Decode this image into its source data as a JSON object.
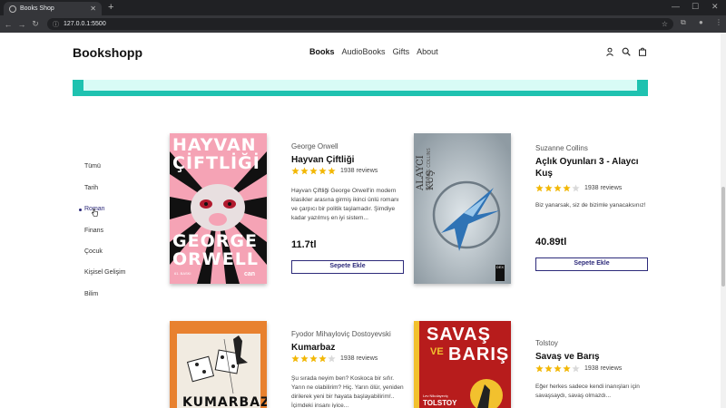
{
  "browser": {
    "tab_title": "Books Shop",
    "new_tab": "+",
    "url": "127.0.0.1:5500"
  },
  "header": {
    "logo": "Bookshopp",
    "nav": [
      {
        "label": "Books",
        "active": true
      },
      {
        "label": "AudioBooks",
        "active": false
      },
      {
        "label": "Gifts",
        "active": false
      },
      {
        "label": "About",
        "active": false
      }
    ]
  },
  "sidebar": {
    "items": [
      {
        "label": "Tümü",
        "active": false
      },
      {
        "label": "Tarih",
        "active": false
      },
      {
        "label": "Roman",
        "active": true
      },
      {
        "label": "Finans",
        "active": false
      },
      {
        "label": "Çocuk",
        "active": false
      },
      {
        "label": "Kişisel Gelişim",
        "active": false
      },
      {
        "label": "Bilim",
        "active": false
      }
    ]
  },
  "colors": {
    "accent": "#2d2a7a",
    "banner": "#1fc2b0",
    "banner_inner": "#d8fbf6",
    "star": "#f2b705",
    "star_empty": "#d9d9d9"
  },
  "cart_label": "Sepete Ekle",
  "books": [
    {
      "author": "George Orwell",
      "title": "Hayvan Çiftliği",
      "stars": 5,
      "reviews": "1938 reviews",
      "description": "Hayvan Çiftliği George Orwell'in modern klasikler arasına girmiş ikinci ünlü romanı ve çarpıcı bir politik taşlamadır. Şimdiye kadar yazılmış en iyi sistem...",
      "price": "11.7tl",
      "cover": {
        "line1": "HAYVAN",
        "line2": "ÇİFTLİĞİ",
        "line3": "GEORGE",
        "line4": "ORWELL",
        "publisher": "can",
        "edition": "61. BASKI"
      }
    },
    {
      "author": "Suzanne Collins",
      "title": "Açlık Oyunları 3 - Alaycı Kuş",
      "stars": 4,
      "reviews": "1938 reviews",
      "description": "Biz yanarsak, siz de bizimle yanacaksınız!",
      "price": "40.89tl",
      "cover": {
        "line1": "ALAYCI KUŞ",
        "line2": "SUZANNE COLLINS",
        "publisher": "DEX"
      }
    },
    {
      "author": "Fyodor Mihayloviç Dostoyevski",
      "title": "Kumarbaz",
      "stars": 4,
      "reviews": "1938 reviews",
      "description": "Şu sırada neyim ben? Koskoca bir sıfır. Yarın ne olabilirim? Hiç. Yarın ölür, yeniden dirilerek yeni bir hayata başlayabilirim!.. İçimdeki insanı iyice...",
      "cover": {
        "line1": "KUMARBAZ"
      }
    },
    {
      "author": "Tolstoy",
      "title": "Savaş ve Barış",
      "stars": 4,
      "reviews": "1938 reviews",
      "description": "Eğer herkes sadece kendi inanışları için savaşsaydı, savaş olmazdı...",
      "cover": {
        "line1": "SAVAŞ",
        "line2": "VE",
        "line3": "BARIŞ",
        "line4": "Lev Nikolayeviç",
        "line5": "TOLSTOY"
      }
    }
  ]
}
